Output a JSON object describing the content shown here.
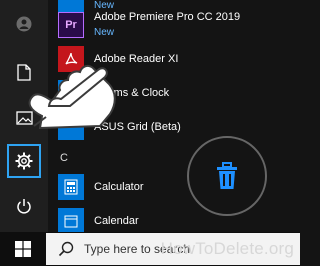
{
  "start_menu": {
    "rail": [
      {
        "name": "account",
        "icon": "user-icon"
      },
      {
        "name": "documents",
        "icon": "document-icon"
      },
      {
        "name": "pictures",
        "icon": "image-icon"
      },
      {
        "name": "settings",
        "icon": "gear-icon",
        "selected": true
      },
      {
        "name": "power",
        "icon": "power-icon"
      }
    ],
    "apps": [
      {
        "name": "New",
        "style": "new-only",
        "icon": "app-icon",
        "tile_color": "#0078d7"
      },
      {
        "name": "Adobe Premiere Pro CC 2019",
        "badge": "New",
        "icon": "premiere-icon",
        "tile_text": "Pr",
        "tile_color": "#2a0c4a",
        "text_color": "#e6a9ff"
      },
      {
        "name": "Adobe Reader XI",
        "icon": "acrobat-icon",
        "tile_color": "#c4161c"
      },
      {
        "name": "Alarms & Clock",
        "icon": "clock-icon",
        "tile_color": "#0078d7"
      },
      {
        "name": "ASUS Grid (Beta)",
        "icon": "asus-grid-icon",
        "tile_color": "#0078d7"
      },
      {
        "name": "Calculator",
        "icon": "calculator-icon",
        "tile_color": "#0078d7"
      },
      {
        "name": "Calendar",
        "icon": "calendar-icon",
        "tile_color": "#0078d7"
      }
    ],
    "section_letter": "C"
  },
  "overlay": {
    "delete_icon": "trash-icon",
    "cursor": "hand-pointer-icon"
  },
  "taskbar": {
    "start_icon": "windows-logo-icon",
    "search_icon": "search-icon",
    "search_placeholder": "Type here to search"
  },
  "watermark": "HowToDelete.org",
  "colors": {
    "accent": "#2ea3f2",
    "app_tile_blue": "#0078d7",
    "new_label": "#67b7ff"
  }
}
